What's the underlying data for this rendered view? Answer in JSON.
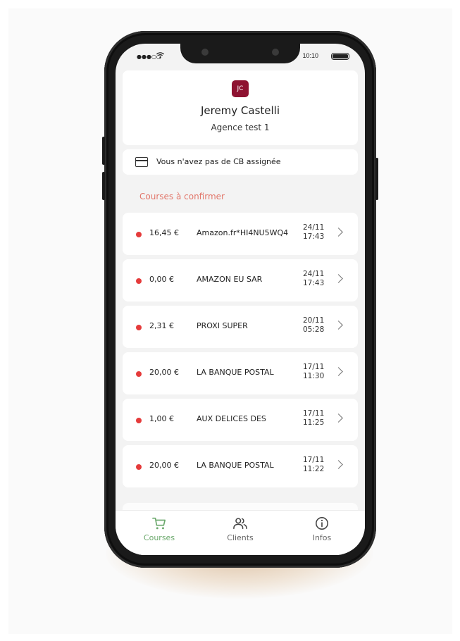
{
  "status_bar": {
    "signal": "●●●○○",
    "time": "10:10"
  },
  "profile": {
    "initials": "JC",
    "name": "Jeremy Castelli",
    "agency": "Agence test 1"
  },
  "card_banner": {
    "text": "Vous n'avez pas de CB assignée",
    "icon": "credit-card-icon"
  },
  "section_title": "Courses à confirmer",
  "transactions": [
    {
      "amount": "16,45 €",
      "merchant": "Amazon.fr*HI4NU5WQ4",
      "date": "24/11",
      "time": "17:43"
    },
    {
      "amount": "0,00 €",
      "merchant": "AMAZON EU SAR",
      "date": "24/11",
      "time": "17:43"
    },
    {
      "amount": "2,31 €",
      "merchant": "PROXI SUPER",
      "date": "20/11",
      "time": "05:28"
    },
    {
      "amount": "20,00 €",
      "merchant": "LA BANQUE POSTAL",
      "date": "17/11",
      "time": "11:30"
    },
    {
      "amount": "1,00 €",
      "merchant": "AUX DELICES DES",
      "date": "17/11",
      "time": "11:25"
    },
    {
      "amount": "20,00 €",
      "merchant": "LA BANQUE POSTAL",
      "date": "17/11",
      "time": "11:22"
    }
  ],
  "tabs": [
    {
      "label": "Courses",
      "icon": "cart-icon",
      "active": true
    },
    {
      "label": "Clients",
      "icon": "users-icon",
      "active": false
    },
    {
      "label": "Infos",
      "icon": "info-icon",
      "active": false
    }
  ],
  "colors": {
    "avatar_bg": "#8e1231",
    "section_title": "#e2776b",
    "status_dot": "#e53b3b",
    "active_tab": "#6aa86b"
  }
}
